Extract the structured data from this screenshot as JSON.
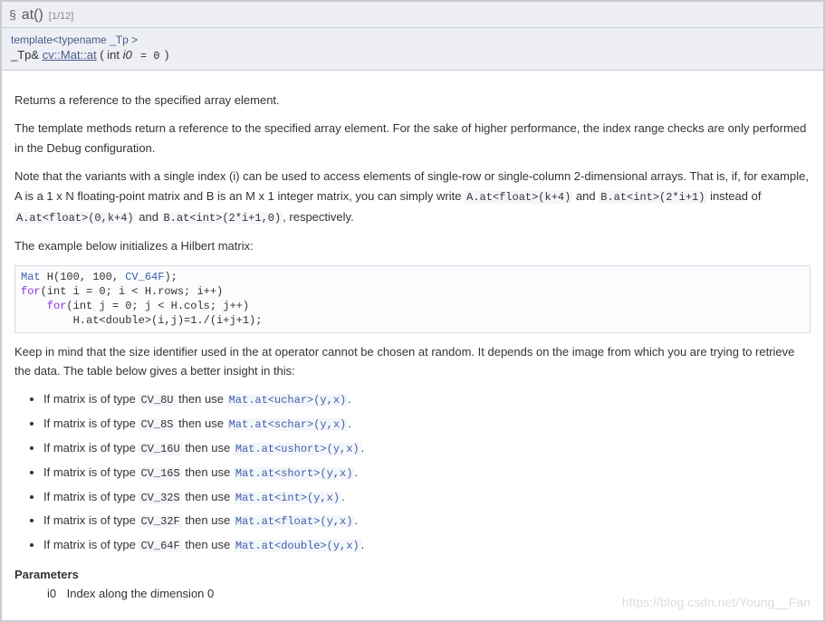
{
  "title": {
    "section_mark": "§",
    "fn_name": "at()",
    "overload": "[1/12]"
  },
  "proto": {
    "template_line": "template<typename _Tp >",
    "ret": "_Tp& ",
    "qual": "cv::Mat::at",
    "paren_open": " ( int  ",
    "arg": "i0",
    "defval": " = 0",
    "paren_close": " )"
  },
  "doc": {
    "p_intro": "Returns a reference to the specified array element.",
    "p_perf": "The template methods return a reference to the specified array element. For the sake of higher performance, the index range checks are only performed in the Debug configuration.",
    "p_note_a": "Note that the variants with a single index (i) can be used to access elements of single-row or single-column 2-dimensional arrays. That is, if, for example, A is a 1 x N floating-point matrix and B is an M x 1 integer matrix, you can simply write ",
    "code1": "A.at<float>(k+4)",
    "and1": " and ",
    "code2": "B.at<int>(2*i+1)",
    "instead": " instead of ",
    "code3": "A.at<float>(0,k+4)",
    "and2": " and ",
    "code4": "B.at<int>(2*i+1,0)",
    "resp": ", respectively.",
    "p_example_lead": "The example below initializes a Hilbert matrix:",
    "code_block": {
      "Mat": "Mat",
      "l1a": " H(100, 100, ",
      "CV64F": "CV_64F",
      "l1b": ");",
      "for1": "for",
      "l2a": "(int i = 0; i < H.rows; i++)",
      "for2": "for",
      "l3a": "(int j = 0; j < H.cols; j++)",
      "l4": "        H.at<double>(i,j)=1./(i+j+1);"
    },
    "p_keep": "Keep in mind that the size identifier used in the at operator cannot be chosen at random. It depends on the image from which you are trying to retrieve the data. The table below gives a better insight in this:",
    "types": [
      {
        "pre": "If matrix is of type ",
        "cv": "CV_8U",
        "mid": " then use ",
        "at": "Mat.at<uchar>(y,x)",
        "post": "."
      },
      {
        "pre": "If matrix is of type ",
        "cv": "CV_8S",
        "mid": " then use ",
        "at": "Mat.at<schar>(y,x)",
        "post": "."
      },
      {
        "pre": "If matrix is of type ",
        "cv": "CV_16U",
        "mid": " then use ",
        "at": "Mat.at<ushort>(y,x)",
        "post": "."
      },
      {
        "pre": "If matrix is of type ",
        "cv": "CV_16S",
        "mid": " then use ",
        "at": "Mat.at<short>(y,x)",
        "post": "."
      },
      {
        "pre": "If matrix is of type ",
        "cv": "CV_32S",
        "mid": " then use ",
        "at": "Mat.at<int>(y,x)",
        "post": "."
      },
      {
        "pre": "If matrix is of type ",
        "cv": "CV_32F",
        "mid": " then use ",
        "at": "Mat.at<float>(y,x)",
        "post": "."
      },
      {
        "pre": "If matrix is of type ",
        "cv": "CV_64F",
        "mid": " then use ",
        "at": "Mat.at<double>(y,x)",
        "post": "."
      }
    ],
    "params_heading": "Parameters",
    "param_name": "i0",
    "param_desc": "Index along the dimension 0",
    "watermark": "https://blog.csdn.net/Young__Fan"
  }
}
